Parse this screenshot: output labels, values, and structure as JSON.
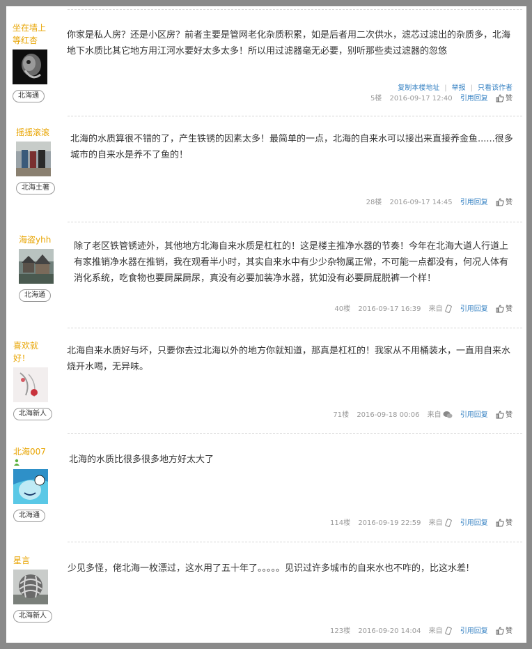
{
  "posts": [
    {
      "user": "坐在墙上等红杏",
      "badge": "北海通",
      "content": "你家是私人房？还是小区房？前者主要是管网老化杂质积累，如是后者用二次供水，滤芯过滤出的杂质多，北海地下水质比其它地方用江河水要好太多太多！所以用过滤器毫无必要，别听那些卖过滤器的忽悠",
      "toolbar": {
        "copy": "复制本楼地址",
        "report": "举报",
        "only_author": "只看该作者"
      },
      "floor": "5楼",
      "time": "2016-09-17 12:40",
      "source": "",
      "reply": "引用回复",
      "like": "赞"
    },
    {
      "user": "摇摇滚滚",
      "badge": "北海土著",
      "content": "北海的水质算很不错的了，产生铁锈的因素太多！最简单的一点，北海的自来水可以接出来直接养金鱼......很多城市的自来水是养不了鱼的！",
      "floor": "28楼",
      "time": "2016-09-17 14:45",
      "source": "",
      "reply": "引用回复",
      "like": "赞"
    },
    {
      "user": "海盗yhh",
      "badge": "北海通",
      "content": "除了老区铁管锈迹外，其他地方北海自来水质是杠杠的！这是楼主推净水器的节奏！今年在北海大道人行道上有家推销净水器在推销，我在观看半小时，其实自来水中有少少杂物属正常，不可能一点都没有，何况人体有消化系统，吃食物也要屙屎屙尿，真没有必要加装净水器，犹如没有必要屙屁脱裤一个样！",
      "floor": "40楼",
      "time": "2016-09-17 16:39",
      "source": "来自",
      "reply": "引用回复",
      "like": "赞"
    },
    {
      "user": "喜欢就好！",
      "badge": "北海新人",
      "content": "北海自来水质好与坏，只要你去过北海以外的地方你就知道，那真是杠杠的！我家从不用桶装水，一直用自来水烧开水喝，无异味。",
      "floor": "71楼",
      "time": "2016-09-18 00:06",
      "source": "来自",
      "reply": "引用回复",
      "like": "赞"
    },
    {
      "user": "北海007",
      "badge": "北海通",
      "content": "北海的水质比很多很多地方好太大了",
      "floor": "114楼",
      "time": "2016-09-19 22:59",
      "source": "来自",
      "reply": "引用回复",
      "like": "赞"
    },
    {
      "user": "星言",
      "badge": "北海新人",
      "content": "少见多怪，佬北海一枚漂过，这水用了五十年了。。。。。见识过许多城市的自来水也不咋的，比这水差!",
      "floor": "123楼",
      "time": "2016-09-20 14:04",
      "source": "来自",
      "reply": "引用回复",
      "like": "赞"
    }
  ],
  "colors": {
    "username": "#e8a400",
    "link": "#3a84c4",
    "meta": "#999999",
    "background": "#8a8a8a"
  }
}
